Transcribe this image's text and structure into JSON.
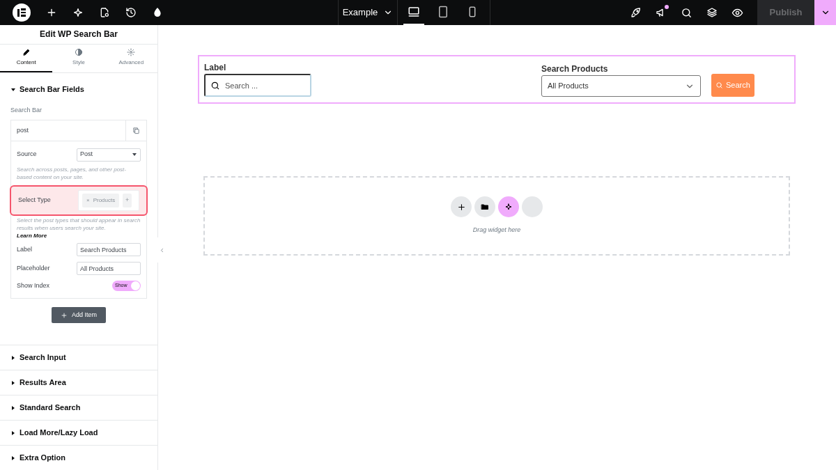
{
  "topbar": {
    "page_title": "Example",
    "devices": [
      {
        "kind": "desktop",
        "selected": true
      },
      {
        "kind": "tablet",
        "selected": false
      },
      {
        "kind": "mobile",
        "selected": false
      }
    ],
    "publish": "Publish",
    "notification": true
  },
  "panel": {
    "title": "Edit WP Search Bar",
    "tabs": [
      {
        "kind": "content",
        "label": "Content",
        "selected": true
      },
      {
        "kind": "style",
        "label": "Style",
        "selected": false
      },
      {
        "kind": "advanced",
        "label": "Advanced",
        "selected": false
      }
    ],
    "section": {
      "title": "Search Bar Fields",
      "expanded": true,
      "list_label": "Search Bar",
      "item": {
        "title": "post",
        "source": {
          "label": "Source",
          "value": "Post",
          "help": "Search across posts, pages, and other post-based content on your site."
        },
        "select_type": {
          "label": "Select Type",
          "tag": "Products",
          "remove": "×",
          "add": "+",
          "highlighted": true,
          "help": "Select the post types that should appear in search results when users search your site.",
          "link": "Learn More"
        },
        "label": {
          "label": "Label",
          "value": "Search Products"
        },
        "placeholder": {
          "label": "Placeholder",
          "value": "All Products"
        },
        "show_index": {
          "label": "Show Index",
          "on": true,
          "text": "Show"
        }
      },
      "add_button": "Add Item"
    },
    "collapsed_sections": [
      "Search Input",
      "Results Area",
      "Standard Search",
      "Load More/Lazy Load",
      "Extra Option"
    ]
  },
  "canvas": {
    "widget": {
      "search_label": "Label",
      "search_placeholder": "Search ...",
      "select_label": "Search Products",
      "select_value": "All Products",
      "button": "Search"
    },
    "drop_zone": {
      "hint": "Drag widget here"
    }
  }
}
